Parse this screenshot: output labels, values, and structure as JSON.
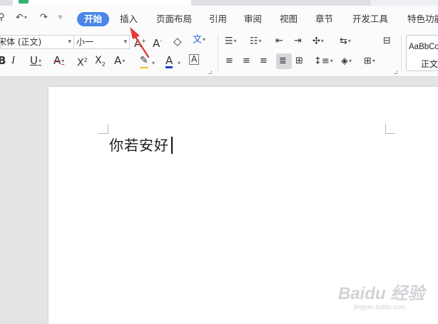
{
  "menu": {
    "tabs": [
      "开始",
      "插入",
      "页面布局",
      "引用",
      "审阅",
      "视图",
      "章节",
      "开发工具",
      "特色功能"
    ],
    "active_tab": "开始"
  },
  "ribbon": {
    "font_name": "宋体 (正文)",
    "font_size": "小一",
    "style_preview": "AaBbCcDd",
    "style_label": "正文",
    "font_color": "#1f3fd1",
    "highlight_color": "#e04040",
    "strike_color": "#d33a3a"
  },
  "document": {
    "text": "你若安好"
  },
  "watermark": {
    "brand": "Baidu 经验",
    "url": "jingyan.baidu.com"
  },
  "colors": {
    "accent": "#4a86e8",
    "annotation_arrow": "#e53935"
  }
}
